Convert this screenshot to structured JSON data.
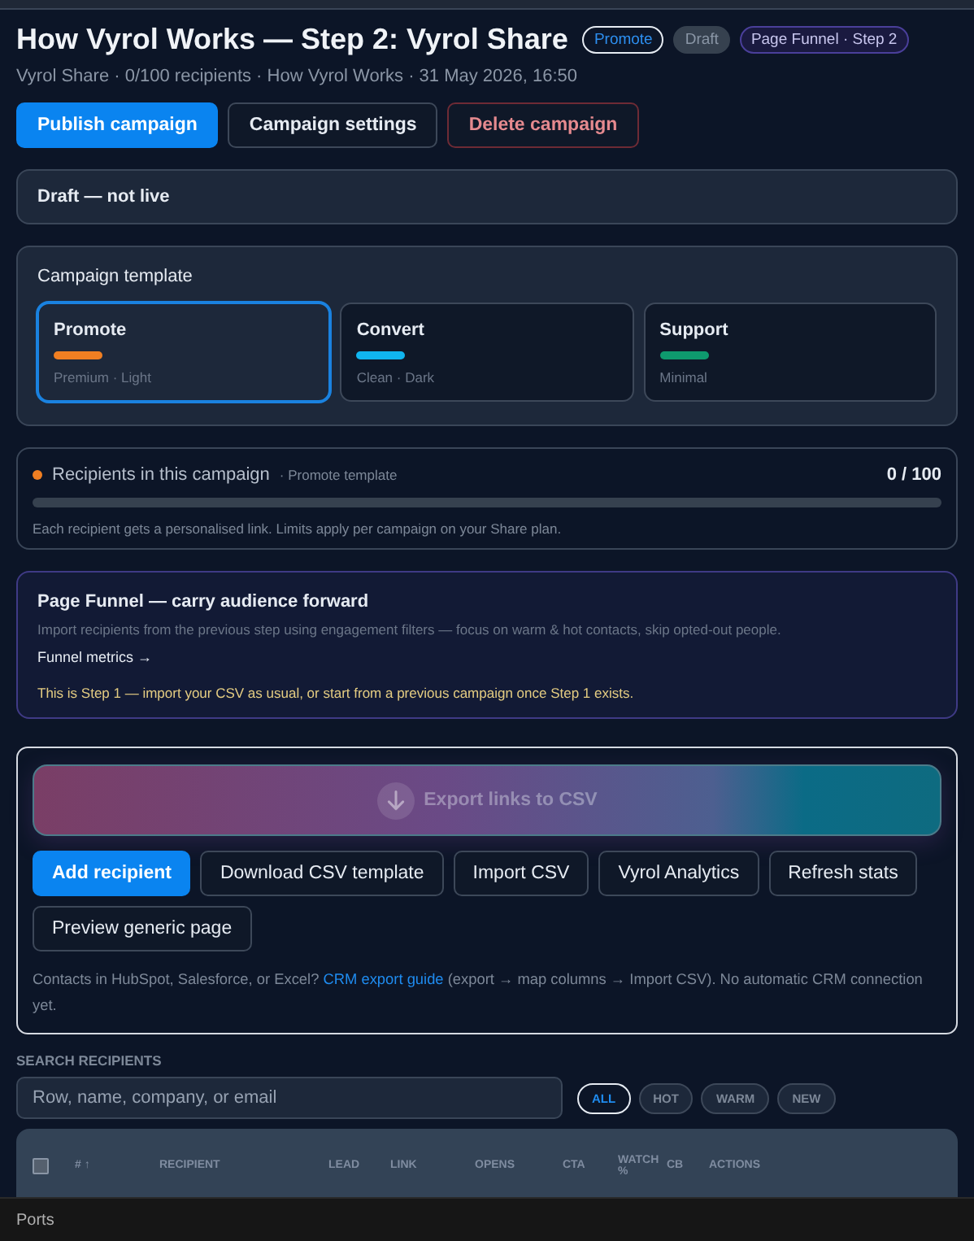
{
  "header": {
    "title": "How Vyrol Works — Step 2: Vyrol Share",
    "badges": [
      {
        "label": "Promote",
        "kind": "outline"
      },
      {
        "label": "Draft",
        "kind": "muted"
      },
      {
        "label": "Page Funnel · Step 2",
        "kind": "funnel"
      }
    ],
    "subtitle": "Vyrol Share · 0/100 recipients · How Vyrol Works · 31 May 2026, 16:50"
  },
  "actions": [
    {
      "label": "Publish campaign",
      "kind": "primary"
    },
    {
      "label": "Campaign settings",
      "kind": "default"
    },
    {
      "label": "Delete campaign",
      "kind": "danger"
    }
  ],
  "status_banner": "Draft — not live",
  "template_picker": {
    "title": "Campaign template",
    "options": [
      {
        "name": "Promote",
        "description": "Premium · Light",
        "color": "#f07f22",
        "selected": true
      },
      {
        "name": "Convert",
        "description": "Clean · Dark",
        "color": "#10b5f0",
        "selected": false
      },
      {
        "name": "Support",
        "description": "Minimal",
        "color": "#0e9a6e",
        "selected": false
      }
    ]
  },
  "recipients": {
    "label": "Recipients in this campaign",
    "template_note": "· Promote template",
    "count": "0 / 100",
    "level": 0,
    "note": "Each recipient gets a personalised link. Limits apply per campaign on your Share plan."
  },
  "funnel": {
    "title": "Page Funnel — carry audience forward",
    "description": "Import recipients from the previous step using engagement filters — focus on warm & hot contacts, skip opted-out people.",
    "link": "Funnel metrics →",
    "notice": "This is Step 1 — import your CSV as usual, or start from a previous campaign once Step 1 exists."
  },
  "export_panel": {
    "export_button": {
      "label": "Export links to CSV",
      "disabled": true
    },
    "buttons": [
      {
        "label": "Add recipient",
        "kind": "primary"
      },
      {
        "label": "Download CSV template",
        "kind": "default"
      },
      {
        "label": "Import CSV",
        "kind": "default"
      },
      {
        "label": "Vyrol Analytics",
        "kind": "default"
      },
      {
        "label": "Refresh stats",
        "kind": "default"
      },
      {
        "label": "Preview generic page",
        "kind": "default"
      }
    ],
    "crm_note_before": "Contacts in HubSpot, Salesforce, or Excel?",
    "crm_link": "CRM export guide",
    "crm_note_after": "(export → map columns → Import CSV). No automatic CRM connection yet."
  },
  "search": {
    "label": "SEARCH RECIPIENTS",
    "placeholder": "Row, name, company, or email",
    "filters": [
      {
        "label": "ALL",
        "selected": true
      },
      {
        "label": "HOT",
        "selected": false
      },
      {
        "label": "WARM",
        "selected": false
      },
      {
        "label": "NEW",
        "selected": false
      }
    ]
  },
  "table": {
    "select_all_checked": false,
    "columns": [
      "# ↑",
      "RECIPIENT",
      "LEAD",
      "LINK",
      "OPENS",
      "CTA",
      "WATCH %",
      "CB",
      "ACTIONS"
    ]
  },
  "status_bar": {
    "label": "Ports"
  }
}
